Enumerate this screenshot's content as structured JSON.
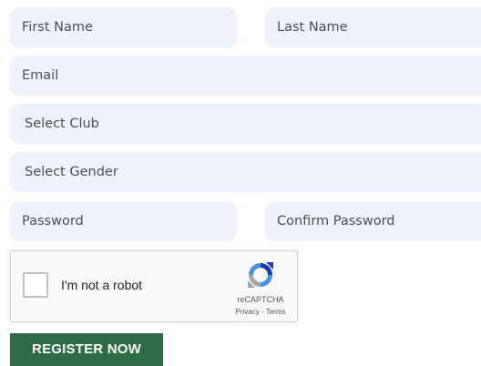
{
  "form": {
    "first_name_placeholder": "First Name",
    "last_name_placeholder": "Last Name",
    "email_placeholder": "Email",
    "club_select_value": "Select Club",
    "gender_select_value": "Select Gender",
    "password_placeholder": "Password",
    "confirm_password_placeholder": "Confirm Password",
    "field_background": "#eef2fb"
  },
  "recaptcha": {
    "label": "I'm not a robot",
    "brand": "reCAPTCHA",
    "privacy": "Privacy",
    "separator": " - ",
    "terms": "Terms",
    "checked": false,
    "icon": "recaptcha-logo-icon"
  },
  "actions": {
    "register_label": "REGISTER NOW",
    "register_color": "#2f6b46"
  }
}
